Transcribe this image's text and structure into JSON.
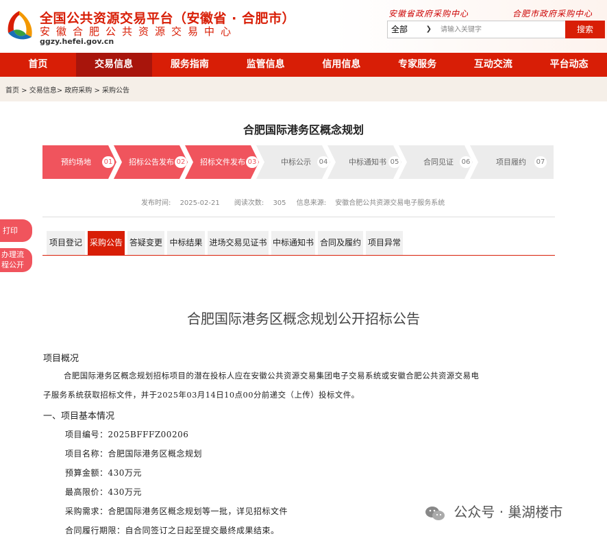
{
  "header": {
    "title": "全国公共资源交易平台（安徽省 · 合肥市）",
    "subtitle": "安徽合肥公共资源交易中心",
    "url": "ggzy.hefei.gov.cn",
    "link_province": "安徽省政府采购中心",
    "link_city": "合肥市政府采购中心"
  },
  "search": {
    "scope": "全部",
    "placeholder": "请输入关键字",
    "button": "搜索"
  },
  "nav": [
    "首页",
    "交易信息",
    "服务指南",
    "监管信息",
    "信用信息",
    "专家服务",
    "互动交流",
    "平台动态"
  ],
  "breadcrumb": "首页 > 交易信息> 政府采购 > 采购公告",
  "page_title": "合肥国际港务区概念规划",
  "steps": [
    {
      "label": "预约场地",
      "num": "01"
    },
    {
      "label": "招标公告发布",
      "num": "02"
    },
    {
      "label": "招标文件发布",
      "num": "03"
    },
    {
      "label": "中标公示",
      "num": "04"
    },
    {
      "label": "中标通知书",
      "num": "05"
    },
    {
      "label": "合同见证",
      "num": "06"
    },
    {
      "label": "项目履约",
      "num": "07"
    }
  ],
  "meta": {
    "date_label": "发布时间:",
    "date": "2025-02-21",
    "views_label": "阅读次数:",
    "views": "305",
    "source_label": "信息来源:",
    "source": "安徽合肥公共资源交易电子服务系统"
  },
  "side": {
    "print": "打印",
    "process_line1": "办理流",
    "process_line2": "程公开"
  },
  "tabs": [
    "项目登记",
    "采购公告",
    "答疑变更",
    "中标结果",
    "进场交易见证书",
    "中标通知书",
    "合同及履约",
    "项目异常"
  ],
  "doc": {
    "title": "合肥国际港务区概念规划公开招标公告",
    "overview_heading": "项目概况",
    "overview_line1": "合肥国际港务区概念规划招标项目的潜在投标人应在安徽公共资源交易集团电子交易系统或安徽合肥公共资源交易电",
    "overview_line2": "子服务系统获取招标文件，并于2025年03月14日10点00分前递交（上传）投标文件。",
    "section1": "一、项目基本情况",
    "items": [
      "项目编号：2025BFFFZ00206",
      "项目名称：合肥国际港务区概念规划",
      "预算金额：430万元",
      "最高限价：430万元",
      "采购需求：合肥国际港务区概念规划等一批，详见招标文件",
      "合同履行期限：自合同签订之日起至提交最终成果结束。"
    ]
  },
  "watermark": "公众号 · 巢湖楼市",
  "colors": {
    "brand": "#d81e06",
    "step_active": "#f0545d",
    "step_inactive": "#ececec"
  }
}
